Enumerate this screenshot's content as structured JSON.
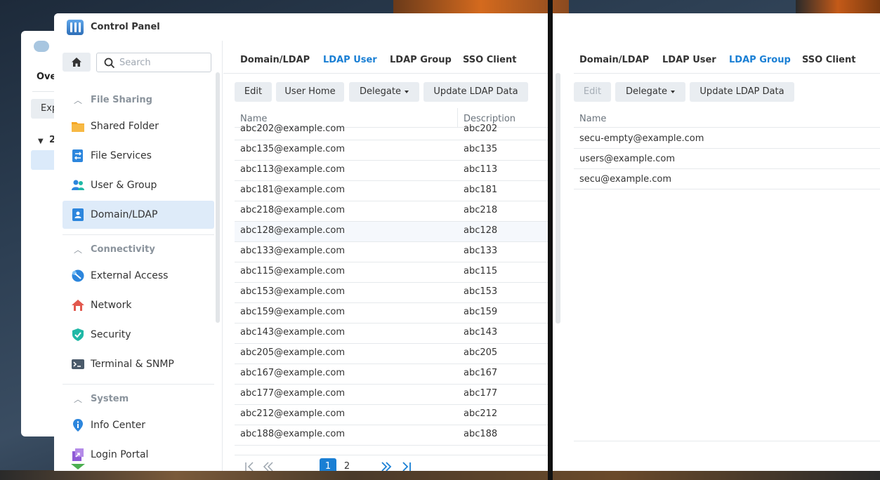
{
  "window": {
    "title": "Control Panel"
  },
  "background_window": {
    "title": "Ove",
    "button": "Exp",
    "group": "2"
  },
  "sidebar": {
    "search_placeholder": "Search",
    "sections": [
      {
        "label": "File Sharing",
        "items": [
          {
            "label": "Shared Folder",
            "icon": "folder-icon"
          },
          {
            "label": "File Services",
            "icon": "file-services-icon"
          },
          {
            "label": "User & Group",
            "icon": "user-group-icon"
          },
          {
            "label": "Domain/LDAP",
            "icon": "domain-ldap-icon",
            "active": true
          }
        ]
      },
      {
        "label": "Connectivity",
        "items": [
          {
            "label": "External Access",
            "icon": "external-access-icon"
          },
          {
            "label": "Network",
            "icon": "network-icon"
          },
          {
            "label": "Security",
            "icon": "shield-icon"
          },
          {
            "label": "Terminal & SNMP",
            "icon": "terminal-icon"
          }
        ]
      },
      {
        "label": "System",
        "items": [
          {
            "label": "Info Center",
            "icon": "info-icon"
          },
          {
            "label": "Login Portal",
            "icon": "login-portal-icon"
          }
        ]
      }
    ]
  },
  "left_pane": {
    "tabs": [
      "Domain/LDAP",
      "LDAP User",
      "LDAP Group",
      "SSO Client"
    ],
    "active_tab": "LDAP User",
    "toolbar": {
      "edit": "Edit",
      "user_home": "User Home",
      "delegate": "Delegate",
      "update": "Update LDAP Data"
    },
    "columns": {
      "name": "Name",
      "description": "Description"
    },
    "rows": [
      {
        "name": "abc202@example.com",
        "description": "abc202"
      },
      {
        "name": "abc135@example.com",
        "description": "abc135"
      },
      {
        "name": "abc113@example.com",
        "description": "abc113"
      },
      {
        "name": "abc181@example.com",
        "description": "abc181"
      },
      {
        "name": "abc218@example.com",
        "description": "abc218"
      },
      {
        "name": "abc128@example.com",
        "description": "abc128"
      },
      {
        "name": "abc133@example.com",
        "description": "abc133"
      },
      {
        "name": "abc115@example.com",
        "description": "abc115"
      },
      {
        "name": "abc153@example.com",
        "description": "abc153"
      },
      {
        "name": "abc159@example.com",
        "description": "abc159"
      },
      {
        "name": "abc143@example.com",
        "description": "abc143"
      },
      {
        "name": "abc205@example.com",
        "description": "abc205"
      },
      {
        "name": "abc167@example.com",
        "description": "abc167"
      },
      {
        "name": "abc177@example.com",
        "description": "abc177"
      },
      {
        "name": "abc212@example.com",
        "description": "abc212"
      },
      {
        "name": "abc188@example.com",
        "description": "abc188"
      }
    ],
    "pager": {
      "current": "1",
      "next": "2"
    }
  },
  "right_pane": {
    "tabs": [
      "Domain/LDAP",
      "LDAP User",
      "LDAP Group",
      "SSO Client"
    ],
    "active_tab": "LDAP Group",
    "toolbar": {
      "edit": "Edit",
      "delegate": "Delegate",
      "update": "Update LDAP Data"
    },
    "columns": {
      "name": "Name"
    },
    "rows": [
      {
        "name": "secu-empty@example.com"
      },
      {
        "name": "users@example.com"
      },
      {
        "name": "secu@example.com"
      }
    ]
  },
  "colors": {
    "accent": "#1a7fd4",
    "active_nav": "#deebf9",
    "button_bg": "#e9edf1"
  }
}
